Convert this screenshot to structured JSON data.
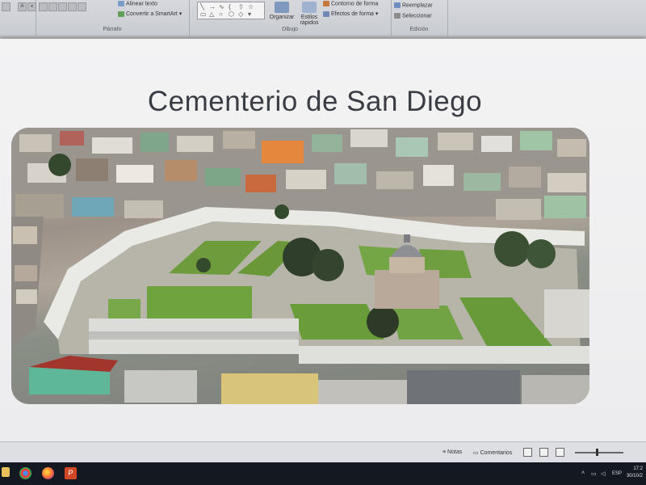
{
  "ribbon": {
    "font_group": {
      "format_buttons": [
        "A"
      ]
    },
    "paragraph_group": {
      "label": "Párrafo",
      "items": [
        "Alinear texto",
        "Convertir a SmartArt"
      ]
    },
    "drawing_group": {
      "label": "Dibujo",
      "arrange_label": "Organizar",
      "quick_styles_label": "Estilos rápidos",
      "items": [
        "Contorno de forma",
        "Efectos de forma"
      ]
    },
    "editing_group": {
      "label": "Edición",
      "items": [
        "Reemplazar",
        "Seleccionar"
      ]
    }
  },
  "slide": {
    "title": "Cementerio de San Diego"
  },
  "statusbar": {
    "notes_label": "Notas",
    "comments_label": "Comentarios"
  },
  "taskbar": {
    "tray": {
      "language": "ESP",
      "time": "17:2",
      "date": "30/10/2"
    }
  },
  "colors": {
    "ribbon_bg": "#d6d8dd",
    "slide_bg": "#f0f0f1",
    "title_text": "#3a3d44",
    "taskbar_bg": "#141821",
    "powerpoint_accent": "#d24726"
  }
}
